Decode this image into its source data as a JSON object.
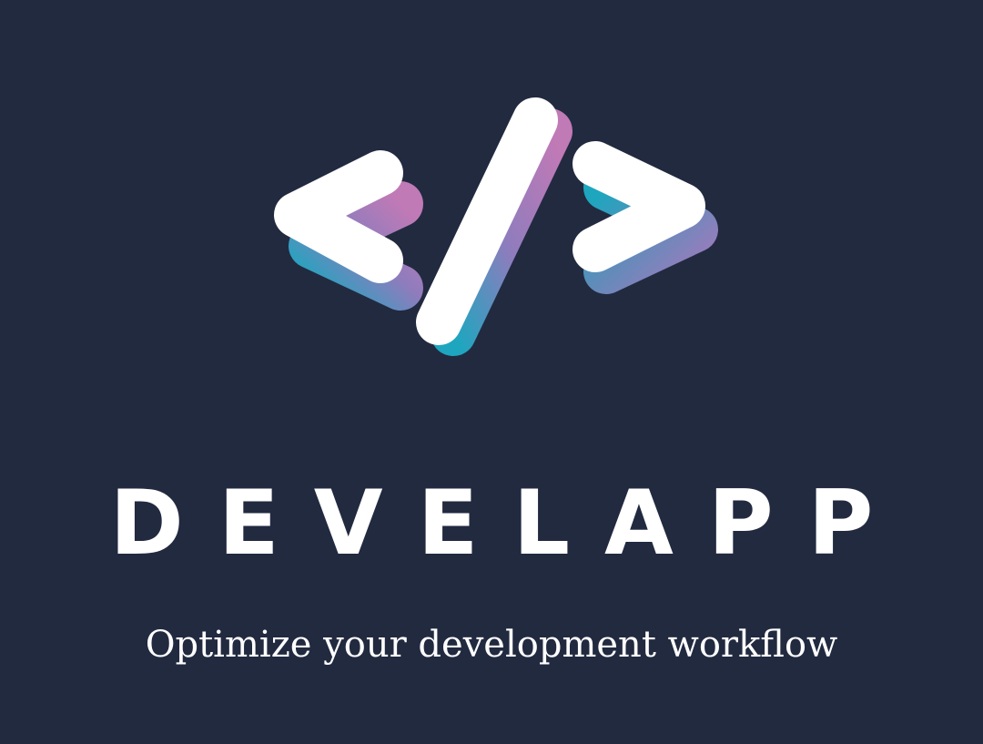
{
  "logo": {
    "icon": "code-brackets-icon",
    "colors": {
      "background": "#222a40",
      "foreground": "#ffffff",
      "gradient_pink": "#b877b9",
      "gradient_purple": "#8f7cbd",
      "gradient_teal": "#1ea6bf"
    }
  },
  "brand": {
    "name": "DEVELAPP",
    "tagline": "Optimize your development workflow"
  }
}
